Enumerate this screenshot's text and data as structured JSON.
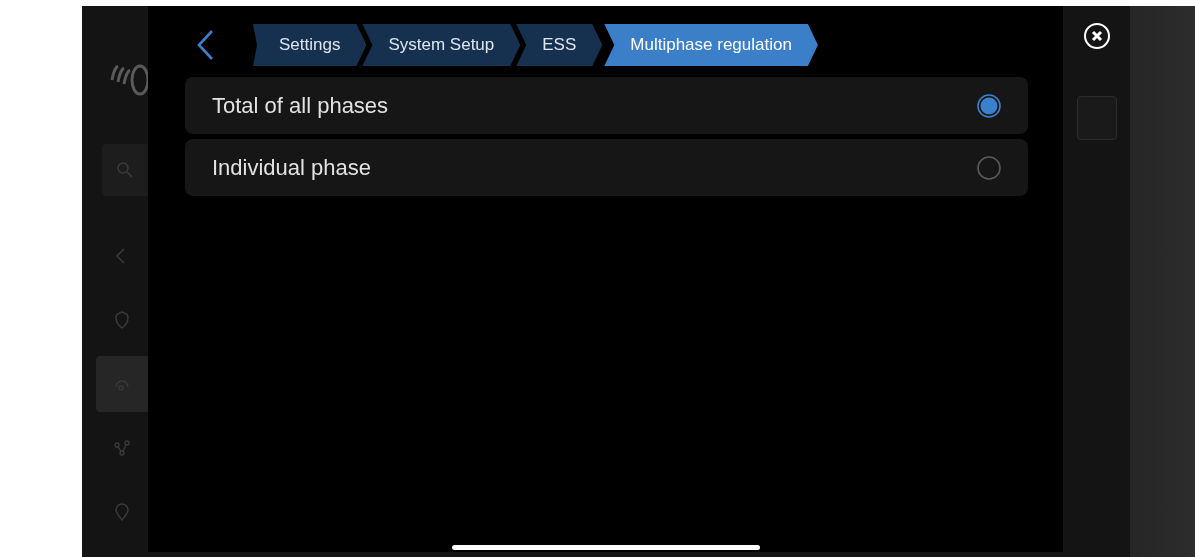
{
  "background_sidebar": {
    "items": [
      {
        "kind": "back",
        "selected": false
      },
      {
        "kind": "shield",
        "selected": false
      },
      {
        "kind": "gauge",
        "selected": true
      },
      {
        "kind": "nodes",
        "selected": false
      },
      {
        "kind": "pin",
        "selected": false
      }
    ]
  },
  "dialog": {
    "breadcrumbs": [
      {
        "label": "Settings",
        "selected": false
      },
      {
        "label": "System Setup",
        "selected": false
      },
      {
        "label": "ESS",
        "selected": false
      },
      {
        "label": "Multiphase regulation",
        "selected": true
      }
    ],
    "options": [
      {
        "label": "Total of all phases",
        "selected": true
      },
      {
        "label": "Individual phase",
        "selected": false
      }
    ]
  }
}
